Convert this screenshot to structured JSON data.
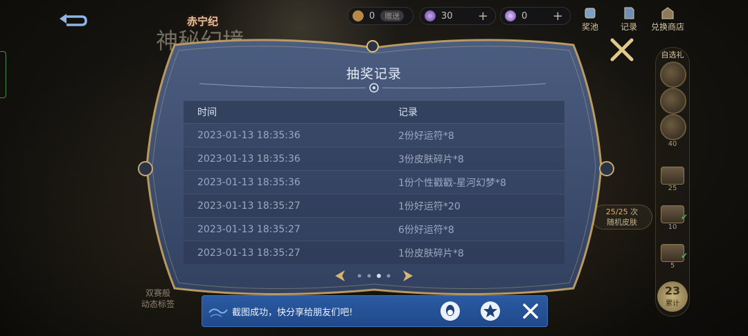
{
  "header": {
    "logo_text": "赤宁纪",
    "logo_big": "神秘幻境"
  },
  "currencies": [
    {
      "icon": "token-icon",
      "value": "0",
      "tag": "赠送",
      "color": "#c99a4a"
    },
    {
      "icon": "diamond-icon",
      "value": "30",
      "color": "#8f72c8"
    },
    {
      "icon": "crystal-icon",
      "value": "0",
      "color": "#a879d8"
    }
  ],
  "top_nav": [
    {
      "label": "奖池",
      "icon": "prize-pool-icon"
    },
    {
      "label": "记录",
      "icon": "record-icon"
    },
    {
      "label": "兑换商店",
      "icon": "shop-icon"
    }
  ],
  "right_rail": {
    "title": "自选礼",
    "chest_counts": [
      "40",
      "25",
      "10",
      "5"
    ],
    "total": "23",
    "total_label": "累计"
  },
  "skin_pill": {
    "progress": "25/25",
    "unit": "次",
    "label": "随机皮肤"
  },
  "left_text": "双赛般\n动态标签",
  "dialog": {
    "title": "抽奖记录",
    "columns": [
      "时间",
      "记录"
    ],
    "rows": [
      {
        "time": "2023-01-13 18:35:36",
        "record": "2份好运符*8"
      },
      {
        "time": "2023-01-13 18:35:36",
        "record": "3份皮肤碎片*8"
      },
      {
        "time": "2023-01-13 18:35:36",
        "record": "1份个性戳戳-星河幻梦*8"
      },
      {
        "time": "2023-01-13 18:35:27",
        "record": "1份好运符*20"
      },
      {
        "time": "2023-01-13 18:35:27",
        "record": "6份好运符*8"
      },
      {
        "time": "2023-01-13 18:35:27",
        "record": "1份皮肤碎片*8"
      }
    ],
    "pager": {
      "pages": 4,
      "current": 3
    }
  },
  "toast": {
    "text": "截图成功，快分享给朋友们吧!"
  }
}
